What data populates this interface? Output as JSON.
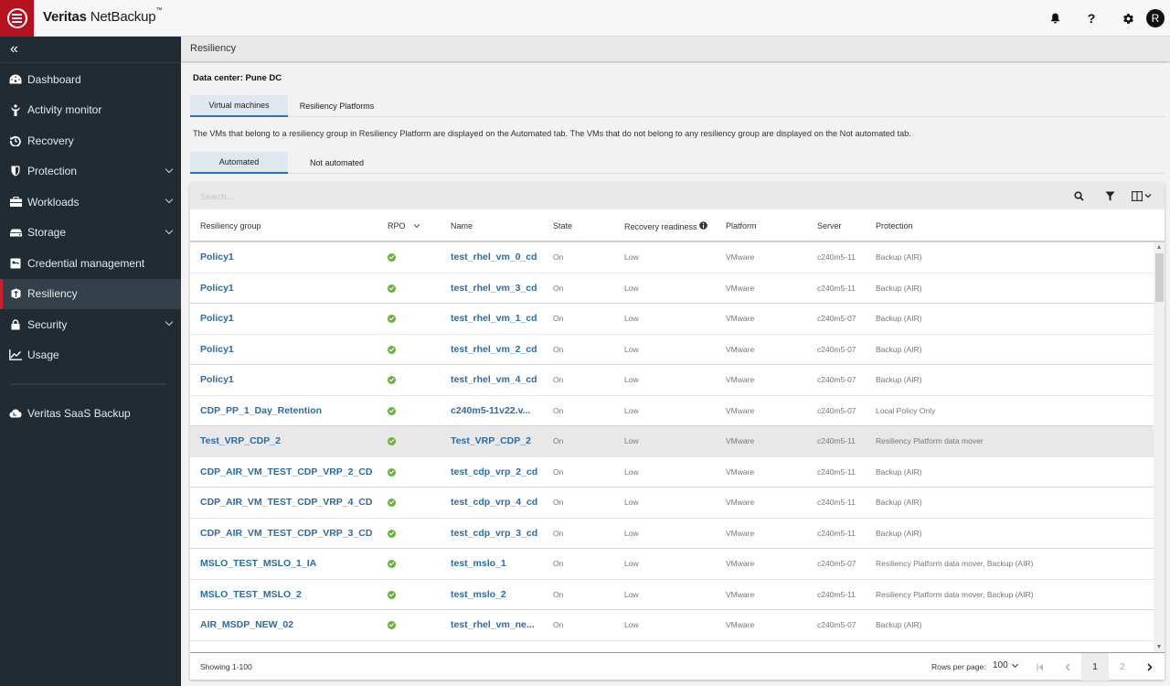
{
  "app": {
    "title_bold": "Veritas",
    "title_light": " NetBackup",
    "trademark": "™",
    "user_initial": "R"
  },
  "header_icons": [
    "bell-icon",
    "help-icon",
    "gear-icon",
    "avatar"
  ],
  "sidebar": {
    "collapse_glyph": "«",
    "items": [
      {
        "label": "Dashboard",
        "icon": "dashboard-icon",
        "expandable": false
      },
      {
        "label": "Activity monitor",
        "icon": "activity-monitor-icon",
        "expandable": false
      },
      {
        "label": "Recovery",
        "icon": "recovery-icon",
        "expandable": false
      },
      {
        "label": "Protection",
        "icon": "shield-icon",
        "expandable": true
      },
      {
        "label": "Workloads",
        "icon": "briefcase-icon",
        "expandable": true
      },
      {
        "label": "Storage",
        "icon": "storage-icon",
        "expandable": true
      },
      {
        "label": "Credential management",
        "icon": "key-icon",
        "expandable": false
      },
      {
        "label": "Resiliency",
        "icon": "resiliency-icon",
        "expandable": false,
        "active": true
      },
      {
        "label": "Security",
        "icon": "lock-icon",
        "expandable": true
      },
      {
        "label": "Usage",
        "icon": "chart-line-icon",
        "expandable": false
      }
    ],
    "extra_items": [
      {
        "label": "Veritas SaaS Backup",
        "icon": "cloud-icon"
      }
    ]
  },
  "breadcrumb": "Resiliency",
  "data_center": "Data center: Pune DC",
  "top_tabs": [
    {
      "label": "Virtual machines",
      "active": true
    },
    {
      "label": "Resiliency Platforms",
      "active": false
    }
  ],
  "info_text": "The VMs that belong to a resiliency group in Resiliency Platform are displayed on the Automated tab. The VMs that do not belong to any resiliency group are displayed on the Not automated tab.",
  "sub_tabs": [
    {
      "label": "Automated",
      "active": true
    },
    {
      "label": "Not automated",
      "active": false
    }
  ],
  "search": {
    "placeholder": "Search...",
    "value": ""
  },
  "table": {
    "columns": {
      "resiliency_group": "Resiliency group",
      "rpo": "RPO",
      "name": "Name",
      "state": "State",
      "recovery_readiness": "Recovery readiness",
      "platform": "Platform",
      "server": "Server",
      "protection": "Protection"
    },
    "rows": [
      {
        "group": "Policy1",
        "rpo": "ok",
        "name": "test_rhel_vm_0_cd",
        "state": "On",
        "readiness": "Low",
        "platform": "VMware",
        "server": "c240m5-11",
        "protection": "Backup (AIR)"
      },
      {
        "group": "Policy1",
        "rpo": "ok",
        "name": "test_rhel_vm_3_cd",
        "state": "On",
        "readiness": "Low",
        "platform": "VMware",
        "server": "c240m5-11",
        "protection": "Backup (AIR)"
      },
      {
        "group": "Policy1",
        "rpo": "ok",
        "name": "test_rhel_vm_1_cd",
        "state": "On",
        "readiness": "Low",
        "platform": "VMware",
        "server": "c240m5-07",
        "protection": "Backup (AIR)"
      },
      {
        "group": "Policy1",
        "rpo": "ok",
        "name": "test_rhel_vm_2_cd",
        "state": "On",
        "readiness": "Low",
        "platform": "VMware",
        "server": "c240m5-07",
        "protection": "Backup (AIR)"
      },
      {
        "group": "Policy1",
        "rpo": "ok",
        "name": "test_rhel_vm_4_cd",
        "state": "On",
        "readiness": "Low",
        "platform": "VMware",
        "server": "c240m5-07",
        "protection": "Backup (AIR)"
      },
      {
        "group": "CDP_PP_1_Day_Retention",
        "rpo": "ok",
        "name": "c240m5-11v22.v...",
        "state": "On",
        "readiness": "Low",
        "platform": "VMware",
        "server": "c240m5-07",
        "protection": "Local Policy Only"
      },
      {
        "group": "Test_VRP_CDP_2",
        "rpo": "ok",
        "name": "Test_VRP_CDP_2",
        "state": "On",
        "readiness": "Low",
        "platform": "VMware",
        "server": "c240m5-11",
        "protection": "Resiliency Platform data mover",
        "highlight": true
      },
      {
        "group": "CDP_AIR_VM_TEST_CDP_VRP_2_CD",
        "rpo": "ok",
        "name": "test_cdp_vrp_2_cd",
        "state": "On",
        "readiness": "Low",
        "platform": "VMware",
        "server": "c240m5-11",
        "protection": "Backup (AIR)"
      },
      {
        "group": "CDP_AIR_VM_TEST_CDP_VRP_4_CD",
        "rpo": "ok",
        "name": "test_cdp_vrp_4_cd",
        "state": "On",
        "readiness": "Low",
        "platform": "VMware",
        "server": "c240m5-11",
        "protection": "Backup (AIR)"
      },
      {
        "group": "CDP_AIR_VM_TEST_CDP_VRP_3_CD",
        "rpo": "ok",
        "name": "test_cdp_vrp_3_cd",
        "state": "On",
        "readiness": "Low",
        "platform": "VMware",
        "server": "c240m5-11",
        "protection": "Backup (AIR)"
      },
      {
        "group": "MSLO_TEST_MSLO_1_IA",
        "rpo": "ok",
        "name": "test_mslo_1",
        "state": "On",
        "readiness": "Low",
        "platform": "VMware",
        "server": "c240m5-07",
        "protection": "Resiliency Platform data mover, Backup (AIR)"
      },
      {
        "group": "MSLO_TEST_MSLO_2",
        "rpo": "ok",
        "name": "test_mslo_2",
        "state": "On",
        "readiness": "Low",
        "platform": "VMware",
        "server": "c240m5-11",
        "protection": "Resiliency Platform data mover, Backup (AIR)"
      },
      {
        "group": "AIR_MSDP_NEW_02",
        "rpo": "ok",
        "name": "test_rhel_vm_ne...",
        "state": "On",
        "readiness": "Low",
        "platform": "VMware",
        "server": "c240m5-07",
        "protection": "Backup (AIR)"
      }
    ]
  },
  "footer": {
    "showing": "Showing 1-100",
    "rows_per_page_label": "Rows per page:",
    "rows_per_page_value": "100",
    "pages": [
      "1",
      "2"
    ],
    "current_page": "1"
  },
  "colors": {
    "brand_red": "#b3121e",
    "sidebar_bg": "#212b33",
    "link_blue": "#2b6ba6",
    "status_green": "#6ab23e",
    "tab_active_bg": "#dfe8f1",
    "tab_active_border": "#2a72b5"
  }
}
